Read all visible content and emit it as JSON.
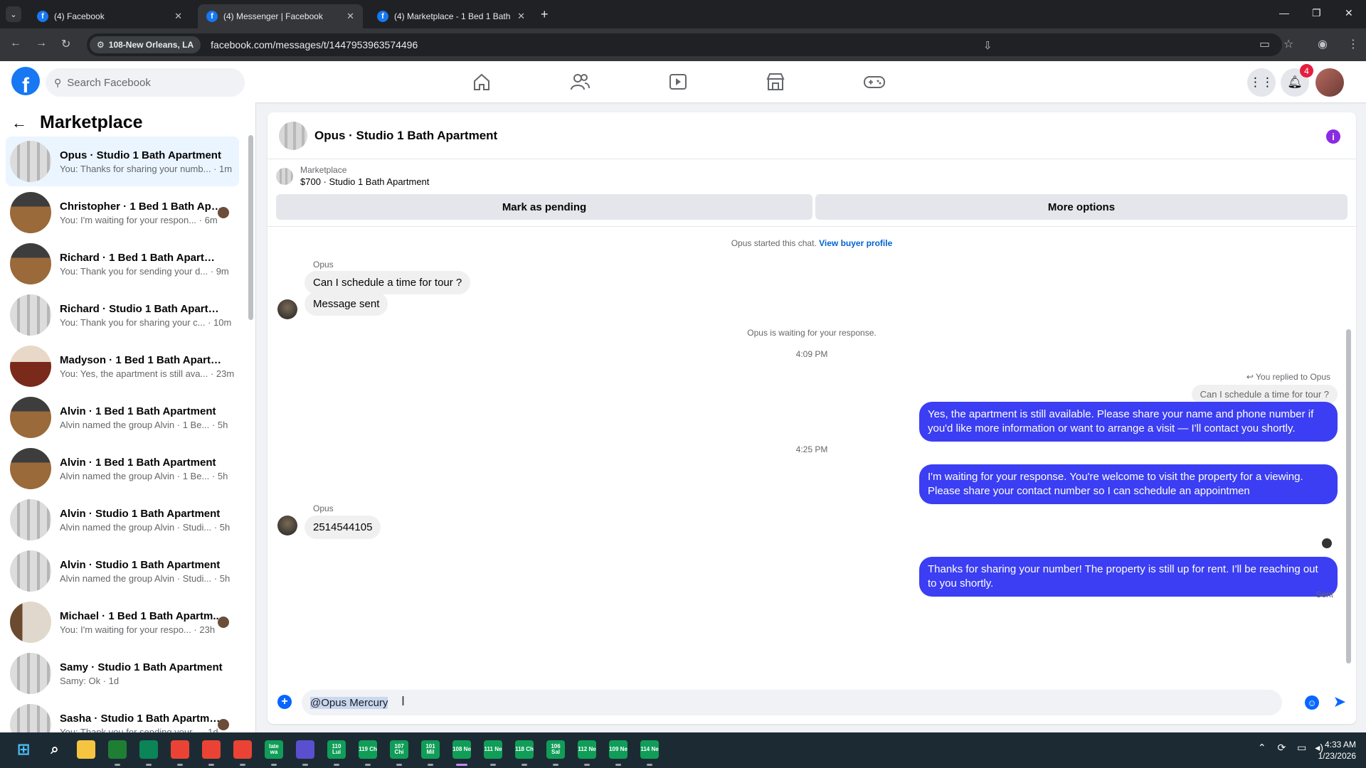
{
  "browser": {
    "tabs": [
      {
        "title": "(4) Facebook"
      },
      {
        "title": "(4) Messenger | Facebook"
      },
      {
        "title": "(4) Marketplace - 1 Bed 1 Bath"
      }
    ],
    "site_chip": "108-New Orleans, LA",
    "url": "facebook.com/messages/t/1447953963574496"
  },
  "fb": {
    "logo": "f",
    "search_placeholder": "Search Facebook",
    "notification_count": "4"
  },
  "sidebar": {
    "title": "Marketplace",
    "conversations": [
      {
        "name": "Opus · Studio 1 Bath Apartment",
        "preview": "You: Thanks for sharing your numb... · 1m",
        "thumb": "light"
      },
      {
        "name": "Christopher · 1 Bed 1 Bath Apa...",
        "preview": "You: I'm waiting for your respon... · 6m",
        "thumb": "wood"
      },
      {
        "name": "Richard · 1 Bed 1 Bath Apartment",
        "preview": "You: Thank you for sending your d... · 9m",
        "thumb": "wood"
      },
      {
        "name": "Richard · Studio 1 Bath Apartment",
        "preview": "You: Thank you for sharing your c... · 10m",
        "thumb": "light"
      },
      {
        "name": "Madyson · 1 Bed 1 Bath Apartme...",
        "preview": "You: Yes, the apartment is still ava... · 23m",
        "thumb": "red"
      },
      {
        "name": "Alvin · 1 Bed 1 Bath Apartment",
        "preview": "Alvin named the group Alvin · 1 Be... · 5h",
        "thumb": "wood"
      },
      {
        "name": "Alvin · 1 Bed 1 Bath Apartment",
        "preview": "Alvin named the group Alvin · 1 Be... · 5h",
        "thumb": "wood"
      },
      {
        "name": "Alvin · Studio 1 Bath Apartment",
        "preview": "Alvin named the group Alvin · Studi... · 5h",
        "thumb": "light"
      },
      {
        "name": "Alvin · Studio 1 Bath Apartment",
        "preview": "Alvin named the group Alvin · Studi... · 5h",
        "thumb": "light"
      },
      {
        "name": "Michael · 1 Bed 1 Bath Apartm...",
        "preview": "You: I'm waiting for your respo... · 23h",
        "thumb": "door"
      },
      {
        "name": "Samy · Studio 1 Bath Apartment",
        "preview": "Samy: Ok · 1d",
        "thumb": "light"
      },
      {
        "name": "Sasha · Studio 1 Bath Apartme...",
        "preview": "You: Thank you for sending your... · 1d",
        "thumb": "light"
      }
    ]
  },
  "chat": {
    "title": "Opus · Studio 1 Bath Apartment",
    "listing_label": "Marketplace",
    "listing_price": "$700 · Studio 1 Bath Apartment",
    "mark_pending": "Mark as pending",
    "more_options": "More options",
    "started_text": "Opus started this chat.",
    "view_profile": "View buyer profile",
    "sender1": "Opus",
    "msg1": "Can I schedule a time for tour ?",
    "msg2": "Message sent",
    "waiting_text": "Opus is waiting for your response.",
    "time1": "4:09 PM",
    "replied_tag": "You replied to Opus",
    "reply_quote": "Can I schedule a time for tour ?",
    "out1": "Yes, the apartment is still available. Please share your name and phone number if you'd like more information or want to arrange a visit — I'll contact you shortly.",
    "time2": "4:25 PM",
    "out2": "I'm waiting for your response. You're welcome to visit the property for a viewing. Please share your contact number so I can schedule an appointmen",
    "sender2": "Opus",
    "msg3": "2514544105",
    "out3": "Thanks for sharing your number! The property is still up for rent. I'll be reaching out to you shortly.",
    "sent_label": "Sent",
    "composer_text": "@Opus Mercury"
  },
  "taskbar": {
    "time": "4:33 AM",
    "date": "1/23/2026",
    "apps": [
      {
        "label": "",
        "color": "#3b82f6",
        "icon": "windows-start"
      },
      {
        "label": "",
        "color": "transparent",
        "icon": "search"
      },
      {
        "label": "",
        "color": "#f5c542",
        "icon": "file-explorer"
      },
      {
        "label": "",
        "color": "#1e7e34",
        "icon": "excel"
      },
      {
        "label": "",
        "color": "#0b8457",
        "icon": "infinity"
      },
      {
        "label": "",
        "color": "#ea4335",
        "icon": "chrome"
      },
      {
        "label": "",
        "color": "#ea4335",
        "icon": "chrome"
      },
      {
        "label": "",
        "color": "#ea4335",
        "icon": "chrome"
      },
      {
        "label": "late wa",
        "color": "#0f9d58",
        "icon": "sheet"
      },
      {
        "label": "",
        "color": "#5a4fcf",
        "icon": "discord"
      },
      {
        "label": "110 Lui",
        "color": "#0f9d58",
        "icon": "sheet"
      },
      {
        "label": "119 Ch",
        "color": "#0f9d58",
        "icon": "sheet"
      },
      {
        "label": "107 Chi",
        "color": "#0f9d58",
        "icon": "sheet"
      },
      {
        "label": "101 Mil",
        "color": "#0f9d58",
        "icon": "sheet"
      },
      {
        "label": "108 Ne",
        "color": "#0f9d58",
        "icon": "sheet"
      },
      {
        "label": "111 Ne",
        "color": "#0f9d58",
        "icon": "sheet"
      },
      {
        "label": "118 Ch",
        "color": "#0f9d58",
        "icon": "sheet"
      },
      {
        "label": "106 Sal",
        "color": "#0f9d58",
        "icon": "sheet"
      },
      {
        "label": "112 Ne",
        "color": "#0f9d58",
        "icon": "sheet"
      },
      {
        "label": "109 Ne",
        "color": "#0f9d58",
        "icon": "sheet"
      },
      {
        "label": "114 Ne",
        "color": "#0f9d58",
        "icon": "sheet"
      }
    ]
  }
}
